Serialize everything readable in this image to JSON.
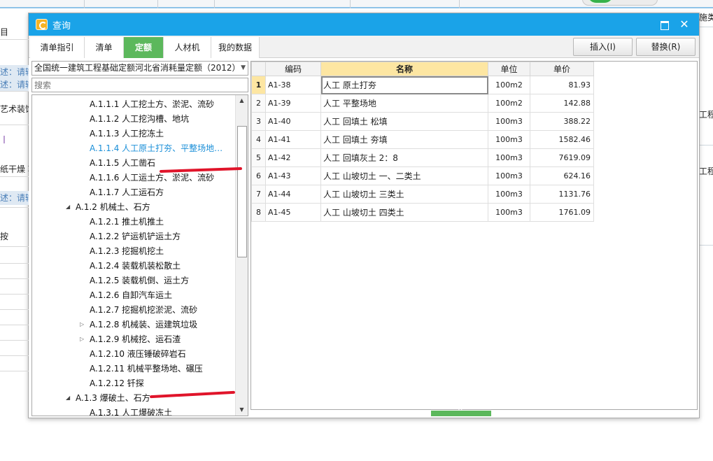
{
  "background": {
    "left_rows": [
      {
        "text": "目",
        "style": "plain"
      },
      {
        "text": "述：请输入",
        "style": "blue"
      },
      {
        "text": "述：请输入",
        "style": "blue"
      },
      {
        "text": "艺术装饰",
        "style": "plain"
      },
      {
        "text": "丨",
        "style": "purple"
      },
      {
        "text": "纸干燥 项",
        "style": "plain"
      },
      {
        "text": "述：请输入",
        "style": "blue"
      },
      {
        "text": "按",
        "style": "plain"
      }
    ],
    "right_texts": [
      "施类",
      "工程",
      "工程"
    ]
  },
  "dialog": {
    "title": "查询",
    "maximize_glyph": "",
    "close_glyph": "✕",
    "tabs": [
      "清单指引",
      "清单",
      "定额",
      "人材机",
      "我的数据"
    ],
    "active_tab": "定额",
    "insert_button": "插入(I)",
    "replace_button": "替换(R)"
  },
  "left_panel": {
    "norm_select": "全国统一建筑工程基础定额河北省消耗量定额（2012）",
    "search_placeholder": "搜索",
    "tree": [
      {
        "label": "A.1.1.1 人工挖土方、淤泥、流砂",
        "level": 3,
        "toggle": ""
      },
      {
        "label": "A.1.1.2 人工挖沟槽、地坑",
        "level": 3,
        "toggle": ""
      },
      {
        "label": "A.1.1.3 人工挖冻土",
        "level": 3,
        "toggle": ""
      },
      {
        "label": "A.1.1.4 人工原土打夯、平整场地…",
        "level": 3,
        "toggle": "",
        "highlight": true
      },
      {
        "label": "A.1.1.5 人工凿石",
        "level": 3,
        "toggle": ""
      },
      {
        "label": "A.1.1.6 人工运土方、淤泥、流砂",
        "level": 3,
        "toggle": ""
      },
      {
        "label": "A.1.1.7 人工运石方",
        "level": 3,
        "toggle": ""
      },
      {
        "label": "A.1.2 机械土、石方",
        "level": 2,
        "toggle": "open"
      },
      {
        "label": "A.1.2.1 推土机推土",
        "level": 3,
        "toggle": ""
      },
      {
        "label": "A.1.2.2 铲运机铲运土方",
        "level": 3,
        "toggle": ""
      },
      {
        "label": "A.1.2.3 挖掘机挖土",
        "level": 3,
        "toggle": ""
      },
      {
        "label": "A.1.2.4 装载机装松散土",
        "level": 3,
        "toggle": ""
      },
      {
        "label": "A.1.2.5 装载机倒、运土方",
        "level": 3,
        "toggle": ""
      },
      {
        "label": "A.1.2.6 自卸汽车运土",
        "level": 3,
        "toggle": ""
      },
      {
        "label": "A.1.2.7 挖掘机挖淤泥、流砂",
        "level": 3,
        "toggle": ""
      },
      {
        "label": "A.1.2.8 机械装、运建筑垃圾",
        "level": 3,
        "toggle": "closed"
      },
      {
        "label": "A.1.2.9 机械挖、运石渣",
        "level": 3,
        "toggle": "closed"
      },
      {
        "label": "A.1.2.10 液压锤破碎岩石",
        "level": 3,
        "toggle": ""
      },
      {
        "label": "A.1.2.11 机械平整场地、碾压",
        "level": 3,
        "toggle": ""
      },
      {
        "label": "A.1.2.12 钎探",
        "level": 3,
        "toggle": ""
      },
      {
        "label": "A.1.3 爆破土、石方",
        "level": 2,
        "toggle": "open"
      },
      {
        "label": "A.1.3.1 人工爆破冻土",
        "level": 3,
        "toggle": ""
      }
    ]
  },
  "grid": {
    "columns": [
      "",
      "编码",
      "名称",
      "单位",
      "单价"
    ],
    "rows": [
      {
        "idx": "1",
        "code": "A1-38",
        "name": "人工 原土打夯",
        "unit": "100m2",
        "price": "81.93"
      },
      {
        "idx": "2",
        "code": "A1-39",
        "name": "人工 平整场地",
        "unit": "100m2",
        "price": "142.88"
      },
      {
        "idx": "3",
        "code": "A1-40",
        "name": "人工 回填土 松填",
        "unit": "100m3",
        "price": "388.22"
      },
      {
        "idx": "4",
        "code": "A1-41",
        "name": "人工 回填土 夯填",
        "unit": "100m3",
        "price": "1582.46"
      },
      {
        "idx": "5",
        "code": "A1-42",
        "name": "人工 回填灰土 2：8",
        "unit": "100m3",
        "price": "7619.09"
      },
      {
        "idx": "6",
        "code": "A1-43",
        "name": "人工 山坡切土 一、二类土",
        "unit": "100m3",
        "price": "624.16"
      },
      {
        "idx": "7",
        "code": "A1-44",
        "name": "人工 山坡切土 三类土",
        "unit": "100m3",
        "price": "1131.76"
      },
      {
        "idx": "8",
        "code": "A1-45",
        "name": "人工 山坡切土 四类土",
        "unit": "100m3",
        "price": "1761.09"
      }
    ]
  },
  "colors": {
    "titlebar": "#1aa3e8",
    "active_tab": "#5cb85c",
    "selected_header": "#fde6a2",
    "highlight_text": "#1b8fd8",
    "annotation_red": "#e0142a"
  }
}
